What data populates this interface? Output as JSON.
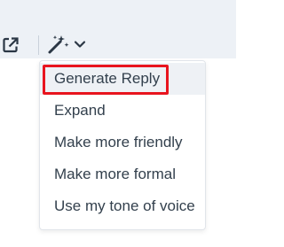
{
  "toolbar": {
    "popout_icon": "external-link-icon",
    "ai_icon": "magic-wand-icon",
    "dropdown_icon": "chevron-down-icon"
  },
  "menu": {
    "items": [
      {
        "label": "Generate Reply",
        "highlighted": true
      },
      {
        "label": "Expand"
      },
      {
        "label": "Make more friendly"
      },
      {
        "label": "Make more formal"
      },
      {
        "label": "Use my tone of voice"
      }
    ]
  },
  "colors": {
    "toolbar_bg": "#edf1f6",
    "highlight_border": "#e8141e",
    "text": "#33404d",
    "icon": "#2b3745"
  }
}
